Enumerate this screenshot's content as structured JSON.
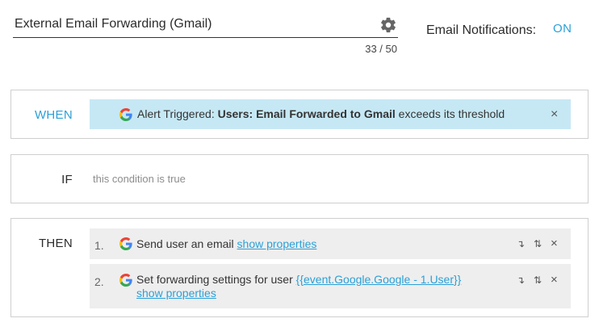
{
  "header": {
    "title_value": "External Email Forwarding (Gmail)",
    "char_count": "33 / 50",
    "notifications_label": "Email Notifications:",
    "notifications_state": "ON"
  },
  "when": {
    "label": "WHEN",
    "trigger_prefix": "Alert Triggered: ",
    "trigger_bold": "Users: Email Forwarded to Gmail",
    "trigger_suffix": " exceeds its threshold",
    "close_icon": "×"
  },
  "if": {
    "label": "IF",
    "condition_text": "this condition is true"
  },
  "then": {
    "label": "THEN",
    "actions": [
      {
        "number": "1.",
        "text": "Send user an email ",
        "link": "show properties"
      },
      {
        "number": "2.",
        "text": "Set forwarding settings for user ",
        "variable_link": "{{event.Google.Google - 1.User}}",
        "link": "show properties"
      }
    ]
  },
  "icons": {
    "gear": "gear-icon",
    "google": "google-icon",
    "move_down": "↴",
    "reorder": "⇅",
    "remove": "×"
  },
  "colors": {
    "accent": "#2aa0d8",
    "trigger_bg": "#c6e8f5",
    "action_bg": "#eeeeee"
  }
}
